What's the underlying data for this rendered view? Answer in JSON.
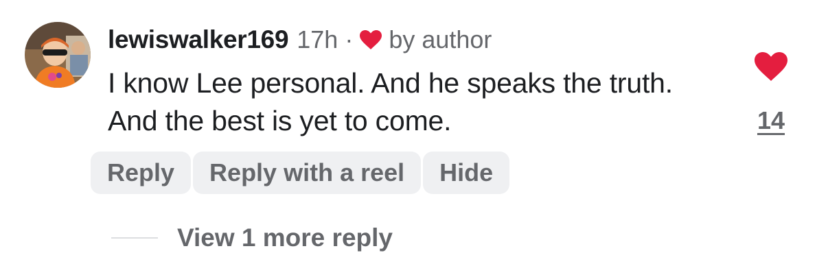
{
  "comment": {
    "username": "lewiswalker169",
    "timestamp": "17h",
    "separator": "·",
    "liked_by_author_icon": "heart-icon",
    "liked_by_author_label": "by author",
    "text": "I know Lee personal. And he speaks the truth. And the best is yet to come.",
    "like_icon": "heart-icon",
    "like_count": "14",
    "actions": {
      "reply": "Reply",
      "reply_with_reel": "Reply with a reel",
      "hide": "Hide"
    },
    "view_more_replies": "View 1 more reply"
  },
  "colors": {
    "heart": "#e41e3f",
    "secondary_text": "#65676b",
    "primary_text": "#1c1e21",
    "chip_background": "#eff0f2"
  }
}
